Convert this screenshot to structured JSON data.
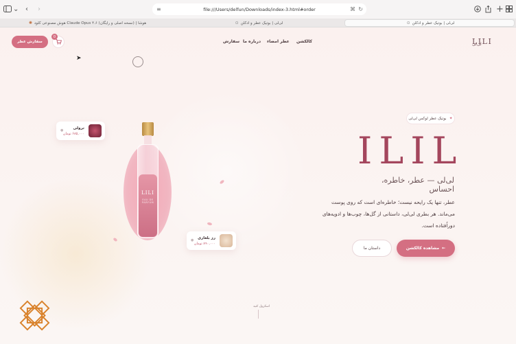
{
  "browser": {
    "url": "file:///Users/delfun/Downloads/index-3.html#order",
    "tabs": [
      {
        "title": "هوش مصنوعی کلود Claude Opus ۴.۶ (نسخه اصلی و رایگان) | هوشا",
        "active": false
      },
      {
        "title": "لی‌لی | بوتیک عطر و ادکلن",
        "active": false
      },
      {
        "title": "لی‌لی | بوتیک عطر و ادکلن",
        "active": true
      }
    ],
    "icons": [
      "sidebar-icon",
      "chevron-down-icon",
      "back-icon",
      "forward-icon",
      "reader-icon",
      "translate-icon",
      "reload-icon",
      "download-icon",
      "share-icon",
      "new-tab-icon",
      "tab-overview-icon"
    ]
  },
  "nav": {
    "logo": "LILI",
    "logo_fa": "لی‌لی",
    "links": [
      "کالکشن",
      "عطر امضاء",
      "درباره ما",
      "سفارش"
    ],
    "order_button": "سفارش عطر",
    "cart_count": "0"
  },
  "hero": {
    "badge": "بوتیک عطر لوکس لی‌لی",
    "title": "ILIL",
    "tagline": "لی‌لی — عطر، خاطره، احساس",
    "description": "عطر، تنها یک رایحه نیست؛ خاطره‌ای است که روی پوست می‌ماند. هر بطری لی‌لی، داستانی از گل‌ها، چوب‌ها و ادویه‌های دوراُفتاده است.",
    "cta_primary": "مشاهده کالکشن",
    "cta_secondary": "داستان ما"
  },
  "bottle": {
    "label": "LILI",
    "sub": "EAU DE PARFUM"
  },
  "cards": [
    {
      "name": "ترولی",
      "price": "۶۸۵,۰۰۰ تومان",
      "accent": "#7a2a3e"
    },
    {
      "name": "رز بلغاری",
      "price": "۸۹۰,۰۰۰ تومان",
      "accent": "#e8cdb0"
    }
  ],
  "scroll_hint": "اسکرول کنید",
  "colors": {
    "accent": "#d46f82",
    "title": "#a4465d",
    "ornament": "#d9822b"
  }
}
